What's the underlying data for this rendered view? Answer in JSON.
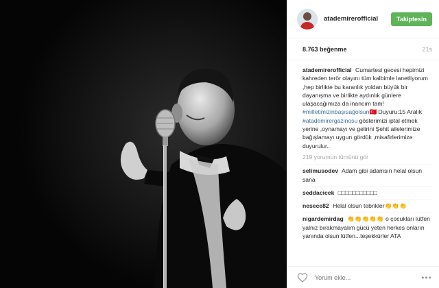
{
  "post": {
    "username": "atademirerofficial",
    "follow_label": "Takiptesin",
    "likes": "8.763 beğenme",
    "time_ago": "21s"
  },
  "caption": {
    "user": "atademirerofficial",
    "text1": "Cumartesi gecesi hepimizi kahreden terör olayını tüm kalbimle lanetliyorum ,hep birlikte bu karanlık yoldan büyük bir dayanışma ve birlikte aydınlık günlere ulaşacağımıza da inancım tam!",
    "hashtag1": "#milletimizinbaşısağolsun",
    "emoji": "🇹🇷",
    "text2": " Duyuru:15 Aralık ",
    "hashtag2": "#atademirergazinosu",
    "text3": " gösterimizi iptal etmek yerine ,oynamayı ve gelirini Şehit ailelerimize bağışlamayı uygun gördük ,misafirlerimize duyurulur.."
  },
  "view_all": "219 yorumun tümünü gör",
  "comments": [
    {
      "user": "selimusodev",
      "text": "Adam gibi adamsın helal olsun sana"
    },
    {
      "user": "seddacicek",
      "text": "□□□□□□□□□□□"
    },
    {
      "user": "nesece82",
      "text": "Helal olsun tebrikler👏👏👏"
    },
    {
      "user": "nigardemirdag",
      "text": "👏👏👏👏👏 o çocukları lütfen yalnız bırakmayalım gücü yeten herkes onların yanında olsun lütfen...teşekkürler ATA"
    }
  ],
  "add_comment": {
    "placeholder": "Yorum ekle..."
  },
  "icons": {
    "like": "heart-icon",
    "more": "more-options-icon"
  },
  "colors": {
    "follow_button": "#5fb359",
    "hashtag": "#3d6f98"
  }
}
